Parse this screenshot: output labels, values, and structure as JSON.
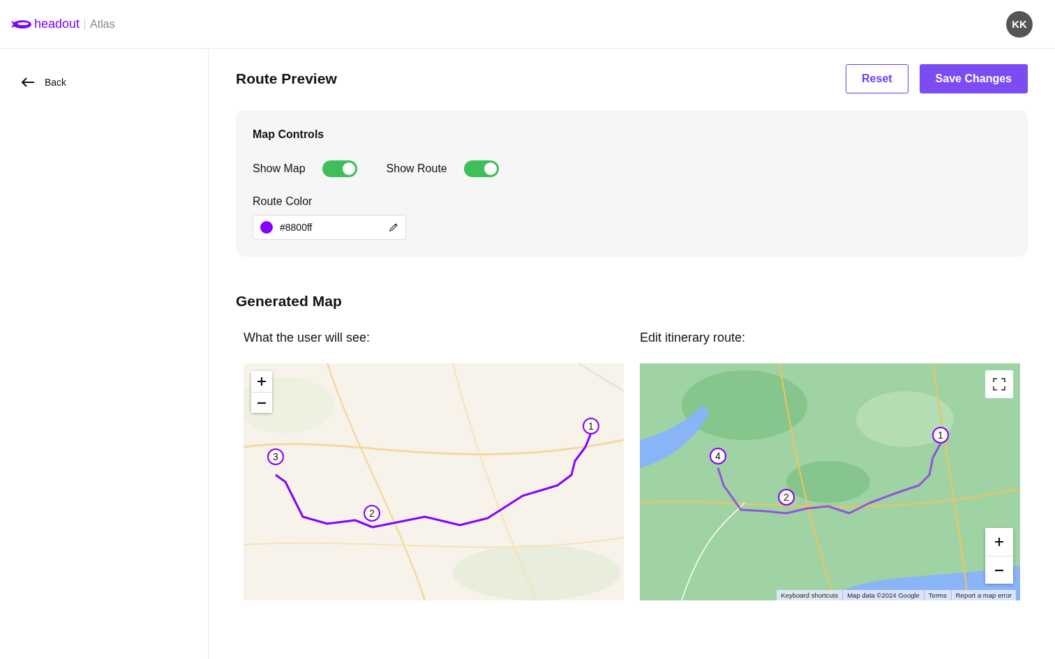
{
  "header": {
    "brand": "headout",
    "product": "Atlas",
    "avatar": "KK"
  },
  "sidebar": {
    "back": "Back"
  },
  "page": {
    "title": "Route Preview",
    "buttons": [
      {
        "label": "Reset",
        "kind": "outline"
      },
      {
        "label": "Save Changes",
        "kind": "primary"
      }
    ]
  },
  "map_controls": {
    "title": "Map Controls",
    "toggles": [
      {
        "label": "Show Map",
        "on": true
      },
      {
        "label": "Show Route",
        "on": true
      }
    ],
    "route_color": {
      "label": "Route Color",
      "value": "#8800ff",
      "color": "#8800ff"
    }
  },
  "generated_map": {
    "title": "Generated Map",
    "panels": [
      {
        "kind": "preview",
        "caption": "What the user will see:",
        "markers": [
          "1",
          "2",
          "3"
        ]
      },
      {
        "kind": "editor",
        "caption": "Edit itinerary route:",
        "markers": [
          "1",
          "2",
          "4"
        ],
        "attribution": [
          "Keyboard shortcuts",
          "Map data ©2024 Google",
          "Terms",
          "Report a map error"
        ]
      }
    ]
  }
}
